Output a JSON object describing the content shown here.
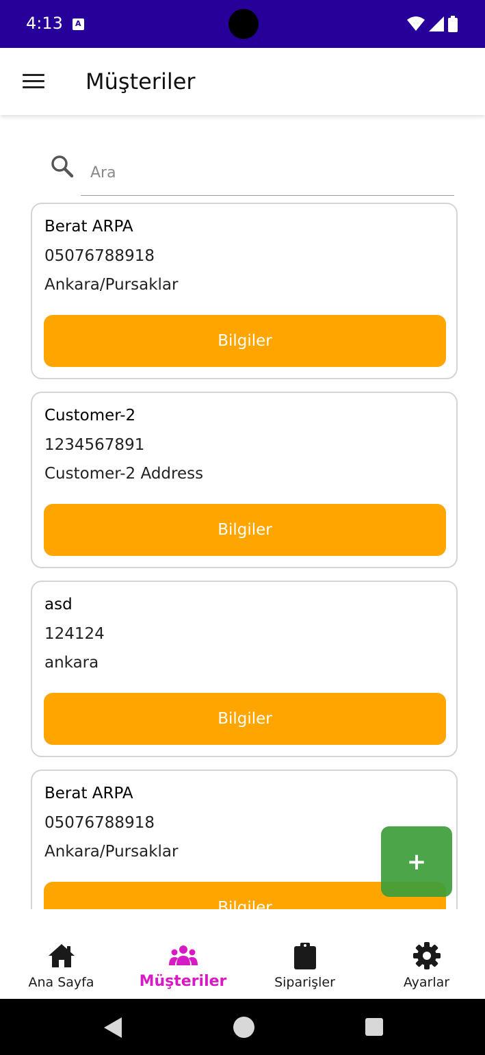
{
  "status_bar": {
    "time": "4:13"
  },
  "app_bar": {
    "title": "Müşteriler"
  },
  "search": {
    "placeholder": "Ara"
  },
  "customers": [
    {
      "name": "Berat ARPA",
      "phone": "05076788918",
      "address": "Ankara/Pursaklar",
      "button_label": "Bilgiler"
    },
    {
      "name": "Customer-2",
      "phone": "1234567891",
      "address": "Customer-2 Address",
      "button_label": "Bilgiler"
    },
    {
      "name": "asd",
      "phone": "124124",
      "address": "ankara",
      "button_label": "Bilgiler"
    },
    {
      "name": "Berat ARPA",
      "phone": "05076788918",
      "address": "Ankara/Pursaklar",
      "button_label": "Bilgiler"
    }
  ],
  "fab": {
    "label": "+"
  },
  "bottom_nav": {
    "items": [
      {
        "label": "Ana Sayfa",
        "icon": "home-icon",
        "active": false
      },
      {
        "label": "Müşteriler",
        "icon": "users-icon",
        "active": true
      },
      {
        "label": "Siparişler",
        "icon": "clipboard-icon",
        "active": false
      },
      {
        "label": "Ayarlar",
        "icon": "gear-icon",
        "active": false
      }
    ]
  },
  "colors": {
    "status_bar": "#270099",
    "button": "#ffa500",
    "fab": "#3d9e3a",
    "active_nav": "#d61bc4",
    "card_border": "#d4d4d4"
  }
}
